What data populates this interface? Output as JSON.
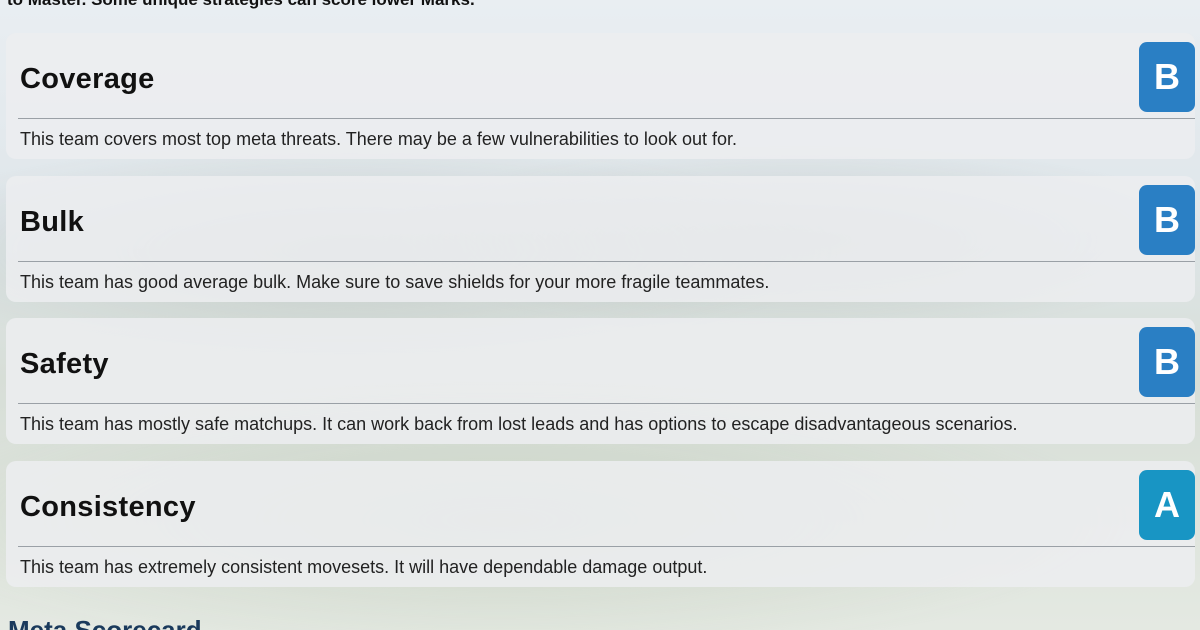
{
  "intro_text": "to Master. Some unique strategies can score lower Marks.",
  "categories": [
    {
      "title": "Coverage",
      "grade": "B",
      "description": "This team covers most top meta threats. There may be a few vulnerabilities to look out for."
    },
    {
      "title": "Bulk",
      "grade": "B",
      "description": "This team has good average bulk. Make sure to save shields for your more fragile teammates."
    },
    {
      "title": "Safety",
      "grade": "B",
      "description": "This team has mostly safe matchups. It can work back from lost leads and has options to escape disadvantageous scenarios."
    },
    {
      "title": "Consistency",
      "grade": "A",
      "description": "This team has extremely consistent movesets. It will have dependable damage output."
    }
  ],
  "next_section_heading": "Meta Scorecard"
}
